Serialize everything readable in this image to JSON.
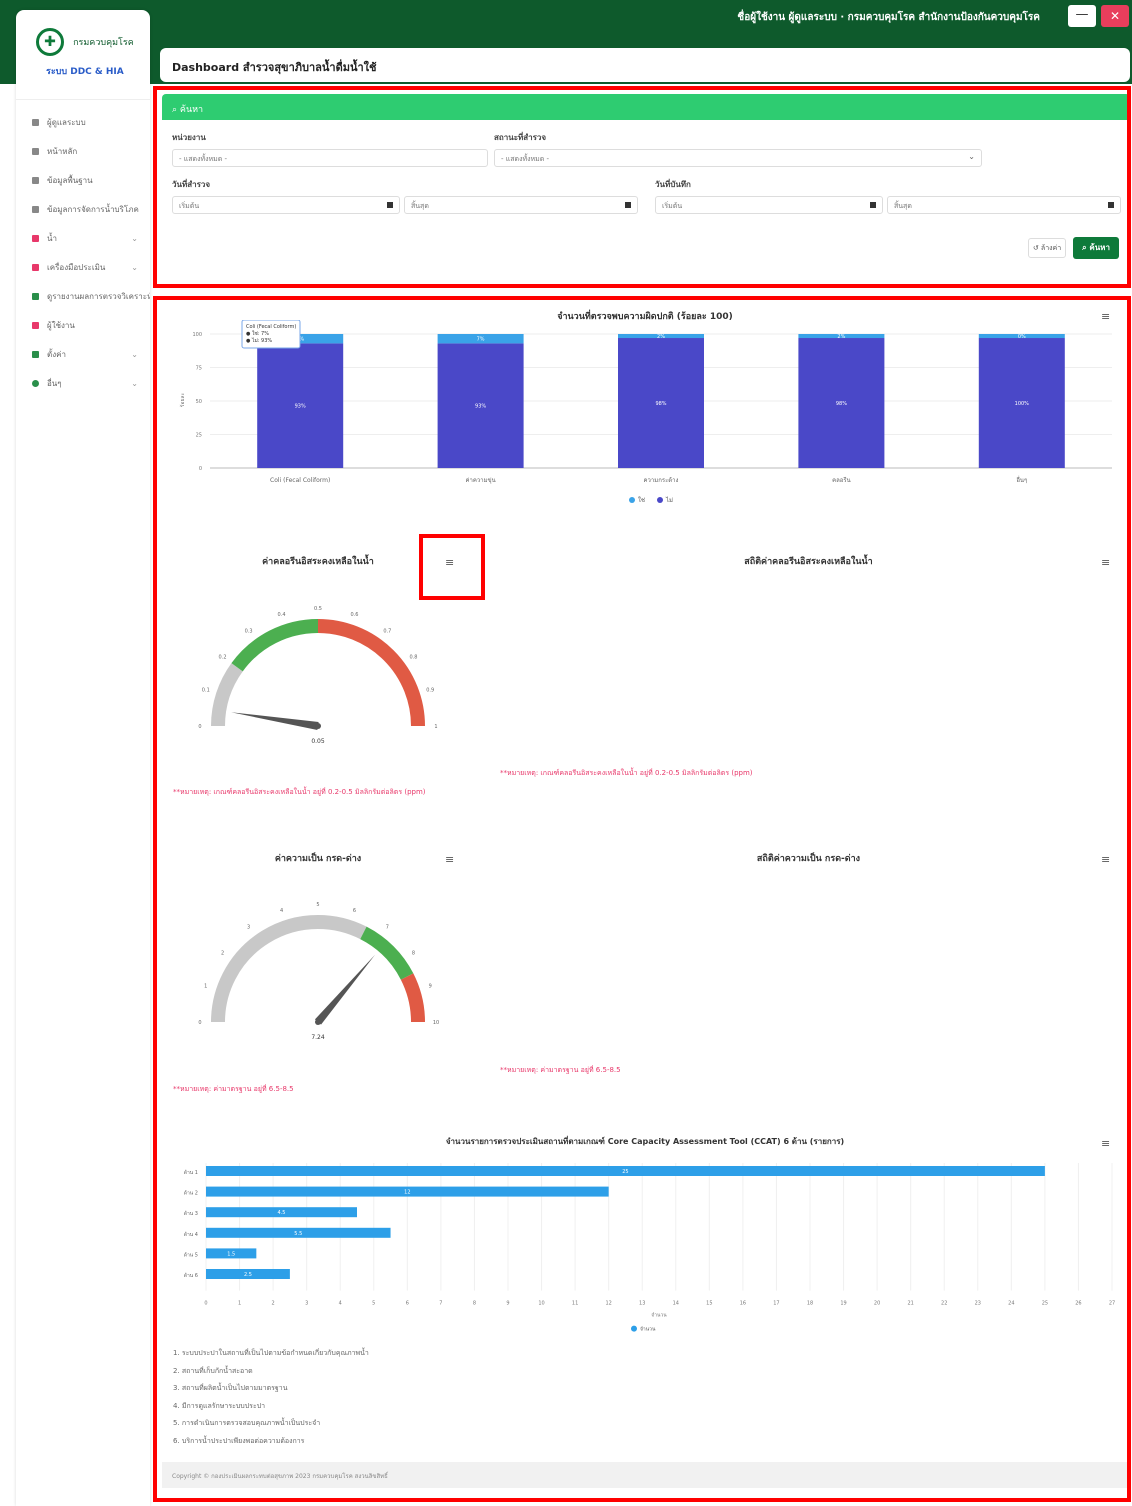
{
  "header": {
    "user_line": "ชื่อผู้ใช้งาน ผู้ดูแลระบบ · กรมควบคุมโรค สำนักงานป้องกันควบคุมโรค",
    "min_icon": "—",
    "close_icon": "✕"
  },
  "sidebar": {
    "logo_mark": "✚",
    "org_name": "กรมควบคุมโรค",
    "system_name": "ระบบ DDC & HIA",
    "items": [
      {
        "label": "ผู้ดูแลระบบ"
      },
      {
        "label": "หน้าหลัก"
      },
      {
        "label": "ข้อมูลพื้นฐาน"
      },
      {
        "label": "ข้อมูลการจัดการน้ำบริโภค"
      },
      {
        "label": "น้ำ",
        "chevron": "⌄"
      },
      {
        "label": "เครื่องมือประเมิน",
        "chevron": "⌄"
      },
      {
        "label": "ดูรายงานผลการตรวจวิเคราะห์"
      },
      {
        "label": "ผู้ใช้งาน"
      },
      {
        "label": "ตั้งค่า",
        "chevron": "⌄"
      },
      {
        "label": "อื่นๆ",
        "chevron": "⌄"
      }
    ]
  },
  "page": {
    "title": "Dashboard สำรวจสุขาภิบาลน้ำดื่มน้ำใช้"
  },
  "search": {
    "header": "ค้นหา",
    "search_icon": "⌕",
    "unit_label": "หน่วยงาน",
    "unit_value": "- แสดงทั้งหมด -",
    "status_label": "สถานะที่สำรวจ",
    "status_value": "- แสดงทั้งหมด -",
    "dropdown_icon": "⌄",
    "date_survey_label": "วันที่สำรวจ",
    "date_survey_from": "เริ่มต้น",
    "date_survey_to": "สิ้นสุด",
    "date_record_label": "วันที่บันทึก",
    "date_record_from": "เริ่มต้น",
    "date_record_to": "สิ้นสุด",
    "clear_label": "ล้างค่า",
    "clear_icon": "↺",
    "submit_label": "ค้นหา"
  },
  "menu_icon": "≡",
  "chart_data": [
    {
      "type": "bar",
      "title": "จำนวนที่ตรวจพบความผิดปกติ (ร้อยละ 100)",
      "ylabel": "ร้อยละ",
      "ylim": [
        0,
        100
      ],
      "yticks": [
        "0",
        "25",
        "50",
        "75",
        "100"
      ],
      "categories": [
        "Coli (Fecal Coliform)",
        "ค่าความขุ่น",
        "ความกระด้าง",
        "คลอรีน",
        "อื่นๆ"
      ],
      "series": [
        {
          "name": "ไม่",
          "color": "#4a48c8",
          "values": [
            93,
            93,
            97,
            97,
            97
          ],
          "labels": [
            "93%",
            "93%",
            "98%",
            "98%",
            "100%"
          ]
        },
        {
          "name": "ใช่",
          "color": "#3aa3e8",
          "values": [
            7,
            7,
            3,
            3,
            3
          ],
          "labels": [
            "7%",
            "7%",
            "2%",
            "2%",
            "0%"
          ]
        }
      ],
      "tooltip": [
        "Coli (Fecal Coliform)",
        "● ใช่: 7%",
        "● ไม่: 93%"
      ]
    },
    {
      "type": "gauge",
      "title": "ค่าคลอรีนอิสระคงเหลือในน้ำ",
      "min": 0,
      "max": 1,
      "value": 0.05,
      "value_label": "0.05",
      "ticks": [
        "0",
        "0.1",
        "0.2",
        "0.3",
        "0.4",
        "0.5",
        "0.6",
        "0.7",
        "0.8",
        "0.9",
        "1"
      ],
      "bands": [
        {
          "from": 0,
          "to": 0.2,
          "color": "#c8c8c8"
        },
        {
          "from": 0.2,
          "to": 0.5,
          "color": "#4caf50"
        },
        {
          "from": 0.5,
          "to": 1,
          "color": "#e05a44"
        }
      ],
      "note": "**หมายเหตุ: เกณฑ์คลอรีนอิสระคงเหลือในน้ำ อยู่ที่ 0.2-0.5 มิลลิกรัมต่อลิตร (ppm)"
    },
    {
      "type": "line",
      "title": "สถิติค่าคลอรีนอิสระคงเหลือในน้ำ",
      "note": "**หมายเหตุ: เกณฑ์คลอรีนอิสระคงเหลือในน้ำ อยู่ที่ 0.2-0.5 มิลลิกรัมต่อลิตร (ppm)"
    },
    {
      "type": "gauge",
      "title": "ค่าความเป็น กรด-ด่าง",
      "min": 0,
      "max": 10,
      "value": 7.24,
      "value_label": "7.24",
      "ticks": [
        "0",
        "1",
        "2",
        "3",
        "4",
        "5",
        "6",
        "7",
        "8",
        "9",
        "10"
      ],
      "bands": [
        {
          "from": 0,
          "to": 6.5,
          "color": "#c8c8c8"
        },
        {
          "from": 6.5,
          "to": 8.5,
          "color": "#4caf50"
        },
        {
          "from": 8.5,
          "to": 10,
          "color": "#e05a44"
        }
      ],
      "note": "**หมายเหตุ: ค่ามาตรฐาน อยู่ที่ 6.5-8.5"
    },
    {
      "type": "line",
      "title": "สถิติค่าความเป็น กรด-ด่าง",
      "note": "**หมายเหตุ: ค่ามาตรฐาน อยู่ที่ 6.5-8.5"
    },
    {
      "type": "bar",
      "orientation": "horizontal",
      "title": "จำนวนรายการตรวจประเมินสถานที่ตามเกณฑ์ Core Capacity Assessment Tool (CCAT) 6 ด้าน (รายการ)",
      "xlabel": "จำนวน",
      "xlim": [
        0,
        27
      ],
      "categories": [
        "ด้าน 1",
        "ด้าน 2",
        "ด้าน 3",
        "ด้าน 4",
        "ด้าน 5",
        "ด้าน 6"
      ],
      "series": [
        {
          "name": "จำนวน",
          "color": "#2d9fe8",
          "values": [
            25,
            12,
            4.5,
            5.5,
            1.5,
            2.5
          ],
          "labels": [
            "25",
            "12",
            "4.5",
            "5.5",
            "1.5",
            "2.5"
          ]
        }
      ],
      "footnotes": [
        "1. ระบบประปาในสถานที่เป็นไปตามข้อกำหนดเกี่ยวกับคุณภาพน้ำ",
        "2. สถานที่เก็บกักน้ำสะอาด",
        "3. สถานที่ผลิตน้ำเป็นไปตามมาตรฐาน",
        "4. มีการดูแลรักษาระบบประปา",
        "5. การดำเนินการตรวจสอบคุณภาพน้ำเป็นประจำ",
        "6. บริการน้ำประปาเพียงพอต่อความต้องการ"
      ]
    }
  ],
  "footer": {
    "text": "Copyright © กองประเมินผลกระทบต่อสุขภาพ 2023 กรมควบคุมโรค สงวนลิขสิทธิ์"
  }
}
